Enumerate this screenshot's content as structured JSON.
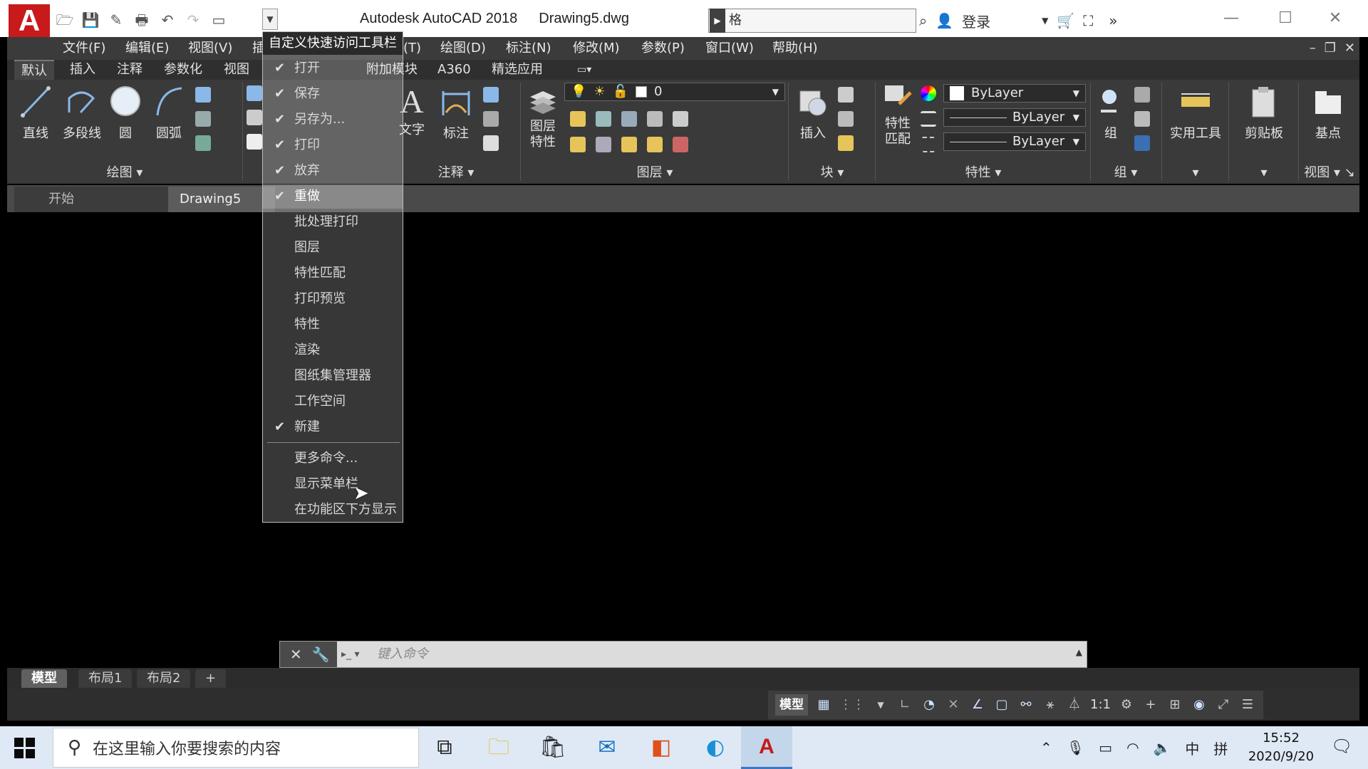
{
  "titlebar": {
    "app_title": "Autodesk AutoCAD 2018",
    "doc_title": "Drawing5.dwg",
    "search_text": "格",
    "login_label": "登录",
    "logo_letter": "A"
  },
  "menubar": {
    "items": [
      "文件(F)",
      "编辑(E)",
      "视图(V)",
      "插",
      "(T)",
      "绘图(D)",
      "标注(N)",
      "修改(M)",
      "参数(P)",
      "窗口(W)",
      "帮助(H)"
    ]
  },
  "ribbon_tabs": [
    "默认",
    "插入",
    "注释",
    "参数化",
    "视图",
    "附加模块",
    "A360",
    "精选应用"
  ],
  "ribbon": {
    "draw_tools": [
      "直线",
      "多段线",
      "圆",
      "圆弧"
    ],
    "draw_panel": "绘图",
    "annotation_tools": [
      "文字",
      "标注"
    ],
    "annotation_panel": "注释",
    "layer_tool": "图层\n特性",
    "layer_panel": "图层",
    "layer_current": "0",
    "block_tool": "插入",
    "block_panel": "块",
    "match_tool": "特性\n匹配",
    "props_color": "ByLayer",
    "props_linetype": "ByLayer",
    "props_lineweight": "ByLayer",
    "props_panel": "特性",
    "group_tool": "组",
    "group_panel": "组",
    "utilities": "实用工具",
    "clipboard": "剪贴板",
    "basepoint": "基点",
    "view_panel": "视图"
  },
  "file_tabs": {
    "start": "开始",
    "drawing": "Drawing5"
  },
  "qat_menu": {
    "title": "自定义快速访问工具栏",
    "items": [
      {
        "label": "打开",
        "checked": true
      },
      {
        "label": "保存",
        "checked": true
      },
      {
        "label": "另存为...",
        "checked": true
      },
      {
        "label": "打印",
        "checked": true
      },
      {
        "label": "放弃",
        "checked": true
      },
      {
        "label": "重做",
        "checked": true
      },
      {
        "label": "批处理打印",
        "checked": false
      },
      {
        "label": "图层",
        "checked": false
      },
      {
        "label": "特性匹配",
        "checked": false
      },
      {
        "label": "打印预览",
        "checked": false
      },
      {
        "label": "特性",
        "checked": false
      },
      {
        "label": "渲染",
        "checked": false
      },
      {
        "label": "图纸集管理器",
        "checked": false
      },
      {
        "label": "工作空间",
        "checked": false
      },
      {
        "label": "新建",
        "checked": true
      }
    ],
    "extra": [
      "更多命令...",
      "显示菜单栏",
      "在功能区下方显示"
    ]
  },
  "command_line": {
    "placeholder": "键入命令"
  },
  "layout_tabs": [
    "模型",
    "布局1",
    "布局2",
    "+"
  ],
  "statusbar": {
    "model": "模型",
    "scale": "1:1"
  },
  "taskbar": {
    "search_placeholder": "在这里输入你要搜索的内容",
    "ime_lang": "中",
    "ime_mode": "拼",
    "time": "15:52",
    "date": "2020/9/20"
  },
  "colors": {
    "accent_red": "#c8191b",
    "dark_bg": "#3a3a3a"
  }
}
